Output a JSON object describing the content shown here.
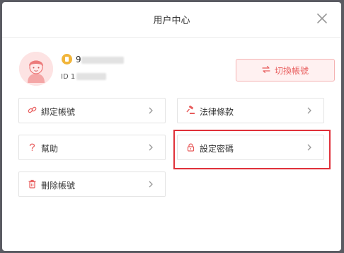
{
  "dialog": {
    "title": "用户中心"
  },
  "user": {
    "phone": "9",
    "id_prefix": "ID 1"
  },
  "switch_account": {
    "label": "切換帳號"
  },
  "menu": {
    "bind_account": "綁定帳號",
    "legal_terms": "法律條款",
    "help": "幫助",
    "set_password": "設定密碼",
    "delete_account": "刪除帳號"
  },
  "colors": {
    "accent": "#e85c5c",
    "highlight": "#e0313a",
    "badge": "#f1b53a"
  }
}
